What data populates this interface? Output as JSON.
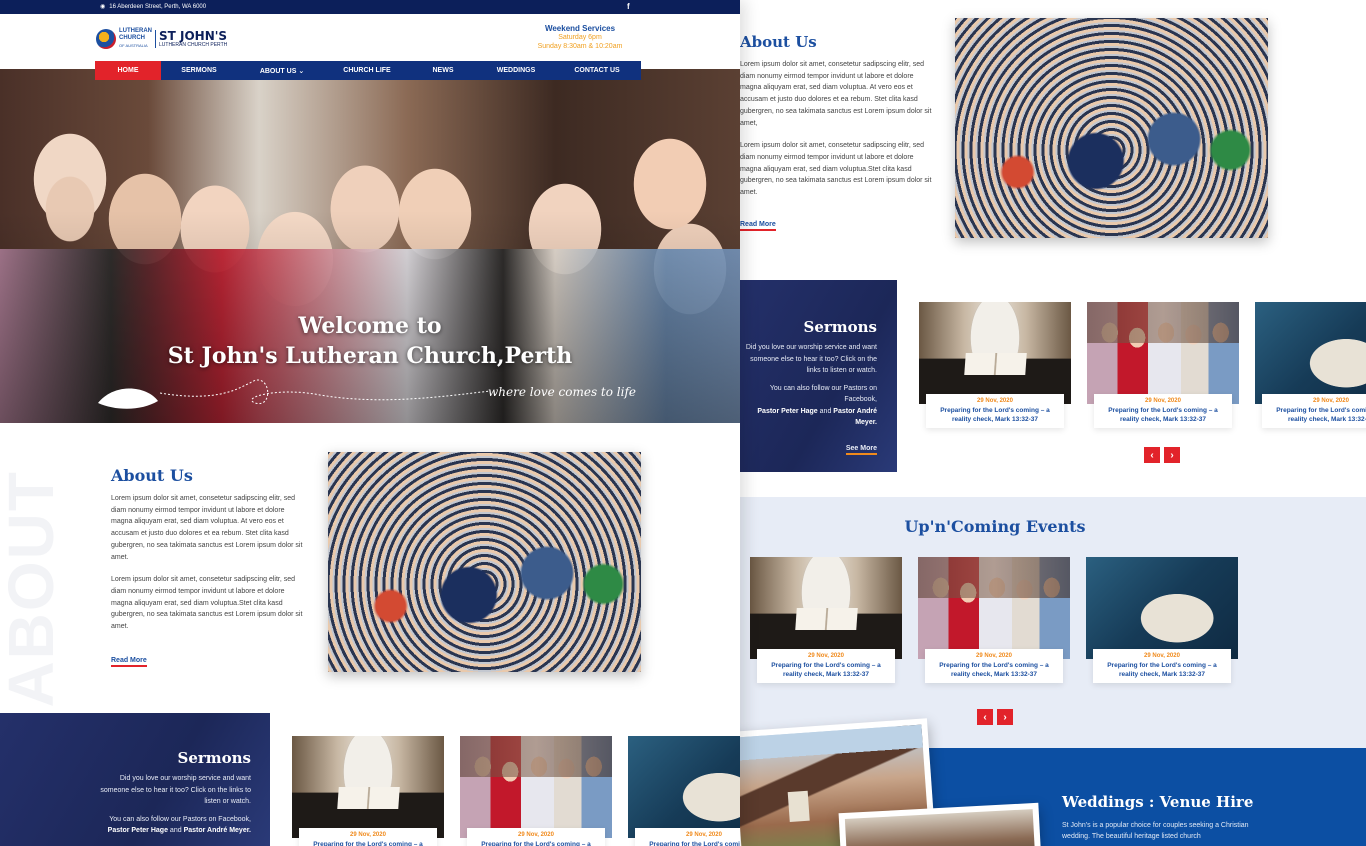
{
  "topbar": {
    "address": "16 Aberdeen Street, Perth, WA 6000",
    "social": "f"
  },
  "logo": {
    "line1": "LUTHERAN",
    "line2": "CHURCH",
    "line3": "OF AUSTRALIA",
    "name": "ST JOHN'S",
    "sub": "LUTHERAN CHURCH PERTH"
  },
  "services": {
    "title": "Weekend Services",
    "line1": "Saturday 6pm",
    "line2": "Sunday 8:30am & 10:20am"
  },
  "nav": [
    {
      "label": "HOME",
      "active": true
    },
    {
      "label": "SERMONS"
    },
    {
      "label": "ABOUT US ⌄"
    },
    {
      "label": "CHURCH LIFE"
    },
    {
      "label": "NEWS"
    },
    {
      "label": "WEDDINGS"
    },
    {
      "label": "CONTACT US"
    }
  ],
  "hero": {
    "line1": "Welcome to",
    "line2": "St John's Lutheran Church,Perth",
    "tagline": "where love comes to life"
  },
  "about": {
    "title": "About Us",
    "p1": "Lorem ipsum dolor sit amet, consetetur sadipscing elitr, sed diam nonumy eirmod tempor invidunt ut labore et dolore magna aliquyam erat, sed diam voluptua. At vero eos et accusam et justo duo dolores et ea rebum. Stet clita kasd gubergren, no sea takimata sanctus est Lorem ipsum dolor sit amet.",
    "p2": "Lorem ipsum dolor sit amet, consetetur sadipscing elitr, sed diam nonumy eirmod tempor invidunt ut labore et dolore magna aliquyam erat, sed diam voluptua.Stet clita kasd gubergren, no sea takimata sanctus est Lorem ipsum dolor sit amet.",
    "read_more": "Read More",
    "watermark": "ABOUT"
  },
  "about_r": {
    "title": "About Us",
    "p1": "Lorem ipsum dolor sit amet, consetetur sadipscing elitr, sed diam nonumy eirmod tempor invidunt ut labore et dolore magna aliquyam erat, sed diam voluptua. At vero eos et accusam et justo duo dolores et ea rebum. Stet clita kasd gubergren, no sea takimata sanctus est Lorem ipsum dolor sit amet,",
    "p2": "Lorem ipsum dolor sit amet, consetetur sadipscing elitr, sed diam nonumy eirmod tempor invidunt ut labore et dolore magna aliquyam erat, sed diam voluptua.Stet clita kasd gubergren, no sea takimata sanctus est Lorem ipsum dolor sit amet.",
    "read_more": "Read More"
  },
  "sermons": {
    "title": "Sermons",
    "p1": "Did you love our worship service and want someone else to hear it too? Click on the links to listen or watch.",
    "p2a": "You can also follow our Pastors on Facebook,",
    "pastor1": "Pastor Peter Hage",
    "and": "and",
    "pastor2": "Pastor André Meyer.",
    "see_more": "See More"
  },
  "cards": [
    {
      "date": "29 Nov, 2020",
      "title": "Preparing for the Lord's coming – a reality check, Mark 13:32-37"
    },
    {
      "date": "29 Nov, 2020",
      "title": "Preparing for the Lord's coming – a reality check, Mark 13:32-37"
    },
    {
      "date": "29 Nov, 2020",
      "title": "Preparing for the Lord's coming – a reality check, Mark 13:32-37"
    }
  ],
  "events": {
    "title": "Up'n'Coming Events"
  },
  "weddings": {
    "title": "Weddings : Venue Hire",
    "text": "St John's is a popular choice for couples seeking a Christian wedding. The beautiful heritage listed church"
  },
  "arrows": {
    "prev": "‹",
    "next": "›"
  }
}
